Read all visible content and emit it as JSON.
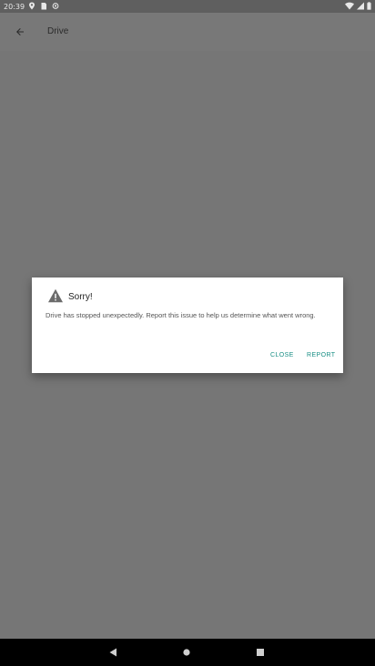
{
  "status_bar": {
    "time": "20:39",
    "left_icons": [
      "location-icon",
      "sim-icon",
      "sync-icon"
    ],
    "right_icons": [
      "wifi-icon",
      "signal-icon",
      "battery-icon"
    ]
  },
  "app_bar": {
    "back_icon": "arrow-back-icon",
    "title": "Drive"
  },
  "dialog": {
    "icon": "warning-icon",
    "title": "Sorry!",
    "message": "Drive has stopped unexpectedly. Report this issue to help us determine what went wrong.",
    "close_label": "CLOSE",
    "report_label": "REPORT",
    "accent_color": "#1a8f85"
  },
  "nav_bar": {
    "back_icon": "nav-back-icon",
    "home_icon": "nav-home-icon",
    "recents_icon": "nav-recents-icon"
  }
}
